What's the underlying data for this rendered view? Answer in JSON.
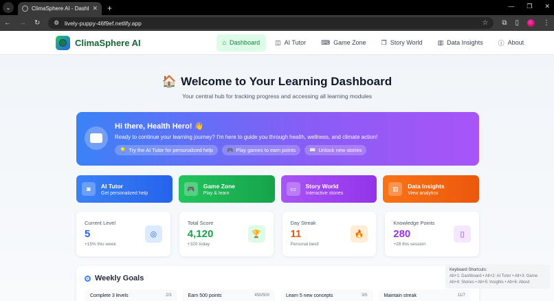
{
  "browser": {
    "tab_title": "ClimaSphere AI - Dashboard",
    "url": "lively-puppy-46f9ef.netlify.app"
  },
  "nav": {
    "brand": "ClimaSphere AI",
    "items": [
      {
        "label": "Dashboard",
        "icon": "home-icon"
      },
      {
        "label": "AI Tutor",
        "icon": "bot-icon"
      },
      {
        "label": "Game Zone",
        "icon": "gamepad-icon"
      },
      {
        "label": "Story World",
        "icon": "book-icon"
      },
      {
        "label": "Data Insights",
        "icon": "chart-icon"
      },
      {
        "label": "About",
        "icon": "info-icon"
      }
    ]
  },
  "hero": {
    "title": "Welcome to Your Learning Dashboard",
    "subtitle": "Your central hub for tracking progress and accessing all learning modules"
  },
  "greeting": {
    "title": "Hi there, Health Hero! 👋",
    "text": "Ready to continue your learning journey? I'm here to guide you through health, wellness, and climate action!",
    "chips": [
      "Try the AI Tutor for personalized help",
      "Play games to earn points",
      "Unlock new stories"
    ]
  },
  "modules": [
    {
      "title": "AI Tutor",
      "sub": "Get personalized help",
      "color": "#3b82f6"
    },
    {
      "title": "Game Zone",
      "sub": "Play & learn",
      "color": "#22c55e"
    },
    {
      "title": "Story World",
      "sub": "Interactive stories",
      "color": "#a855f7"
    },
    {
      "title": "Data Insights",
      "sub": "View analytics",
      "color": "#f97316"
    }
  ],
  "stats": [
    {
      "label": "Current Level",
      "value": "5",
      "note": "+15% this week",
      "color": "#2563eb",
      "bg": "#dbeafe"
    },
    {
      "label": "Total Score",
      "value": "4,120",
      "note": "+320 today",
      "color": "#16a34a",
      "bg": "#dcfce7"
    },
    {
      "label": "Day Streak",
      "value": "11",
      "note": "Personal best!",
      "color": "#ea580c",
      "bg": "#ffedd5"
    },
    {
      "label": "Knowledge Points",
      "value": "280",
      "note": "+28 this session",
      "color": "#9333ea",
      "bg": "#f3e8ff"
    }
  ],
  "goals": {
    "title": "Weekly Goals",
    "items": [
      {
        "label": "Complete 3 levels",
        "count": "2/3"
      },
      {
        "label": "Earn 500 points",
        "count": "450/500"
      },
      {
        "label": "Learn 5 new concepts",
        "count": "3/5"
      },
      {
        "label": "Maintain streak",
        "count": "11/7"
      }
    ]
  },
  "shortcuts": {
    "title": "Keyboard Shortcuts:",
    "line1": "Alt+1: Dashboard • Alt+2: AI Tutor • Alt+3: Game",
    "line2": "Alt+4: Stories • Alt+5: Insights • Alt+6: About"
  }
}
